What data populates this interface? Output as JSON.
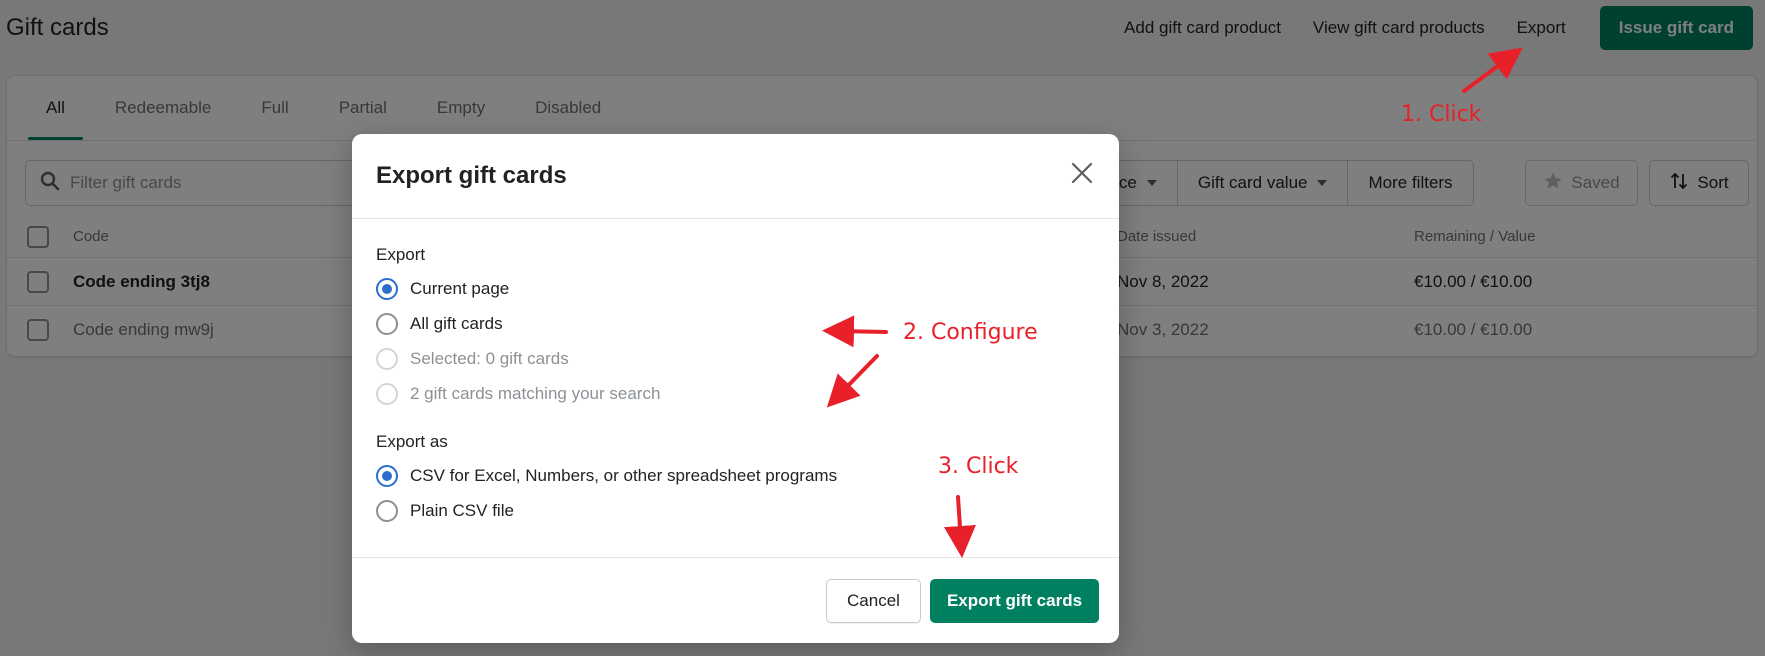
{
  "page": {
    "title": "Gift cards",
    "header_actions": {
      "add_product": "Add gift card product",
      "view_products": "View gift card products",
      "export": "Export",
      "issue": "Issue gift card"
    },
    "tabs": [
      {
        "label": "All",
        "active": true
      },
      {
        "label": "Redeemable",
        "active": false
      },
      {
        "label": "Full",
        "active": false
      },
      {
        "label": "Partial",
        "active": false
      },
      {
        "label": "Empty",
        "active": false
      },
      {
        "label": "Disabled",
        "active": false
      }
    ],
    "search": {
      "placeholder": "Filter gift cards",
      "value": ""
    },
    "filters": {
      "balance_partial": "ance",
      "gift_card_value": "Gift card value",
      "more_filters": "More filters",
      "saved": "Saved",
      "sort": "Sort"
    },
    "table": {
      "columns": {
        "code": "Code",
        "date_issued": "Date issued",
        "remaining_value": "Remaining / Value"
      },
      "rows": [
        {
          "code": "Code ending 3tj8",
          "date_issued": "Nov 8, 2022",
          "remaining_value": "€10.00 / €10.00"
        },
        {
          "code": "Code ending mw9j",
          "date_issued": "Nov 3, 2022",
          "remaining_value": "€10.00 / €10.00"
        }
      ]
    }
  },
  "modal": {
    "title": "Export gift cards",
    "export_section": {
      "label": "Export",
      "options": [
        {
          "label": "Current page",
          "checked": true,
          "disabled": false
        },
        {
          "label": "All gift cards",
          "checked": false,
          "disabled": false
        },
        {
          "label": "Selected: 0 gift cards",
          "checked": false,
          "disabled": true
        },
        {
          "label": "2 gift cards matching your search",
          "checked": false,
          "disabled": true
        }
      ]
    },
    "export_as_section": {
      "label": "Export as",
      "options": [
        {
          "label": "CSV for Excel, Numbers, or other spreadsheet programs",
          "checked": true
        },
        {
          "label": "Plain CSV file",
          "checked": false
        }
      ]
    },
    "cancel_label": "Cancel",
    "submit_label": "Export gift cards"
  },
  "annotations": {
    "step1": "1. Click",
    "step2": "2. Configure",
    "step3": "3. Click"
  },
  "colors": {
    "primary": "#008060",
    "radio_selected": "#2c6ecb",
    "annotation": "#e8202a"
  }
}
